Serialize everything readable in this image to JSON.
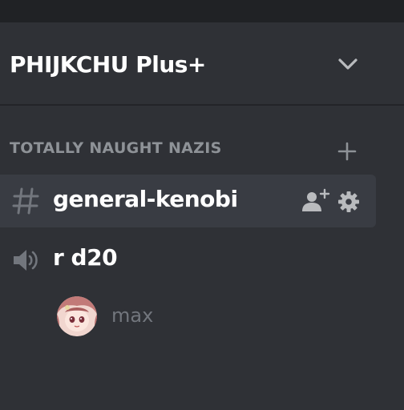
{
  "server": {
    "name": "PHIJKCHU Plus+",
    "menu_icon": "chevron-down-icon"
  },
  "category": {
    "name": "TOTALLY NAUGHT NAZIS",
    "add_icon": "plus-icon"
  },
  "text_channel": {
    "name": "general-kenobi",
    "type_icon": "hash-icon",
    "actions": [
      "invite-icon",
      "gear-icon"
    ],
    "selected": true
  },
  "voice_channel": {
    "name": "r d20",
    "type_icon": "speaker-icon",
    "members": [
      {
        "name": "max",
        "avatar": "avatar"
      }
    ]
  },
  "colors": {
    "sidebar_bg": "#2f3136",
    "titlebar_bg": "#202225",
    "selected_bg": "#393c43",
    "text_primary": "#ffffff",
    "text_muted": "#8e9297",
    "text_member": "#72767d"
  }
}
